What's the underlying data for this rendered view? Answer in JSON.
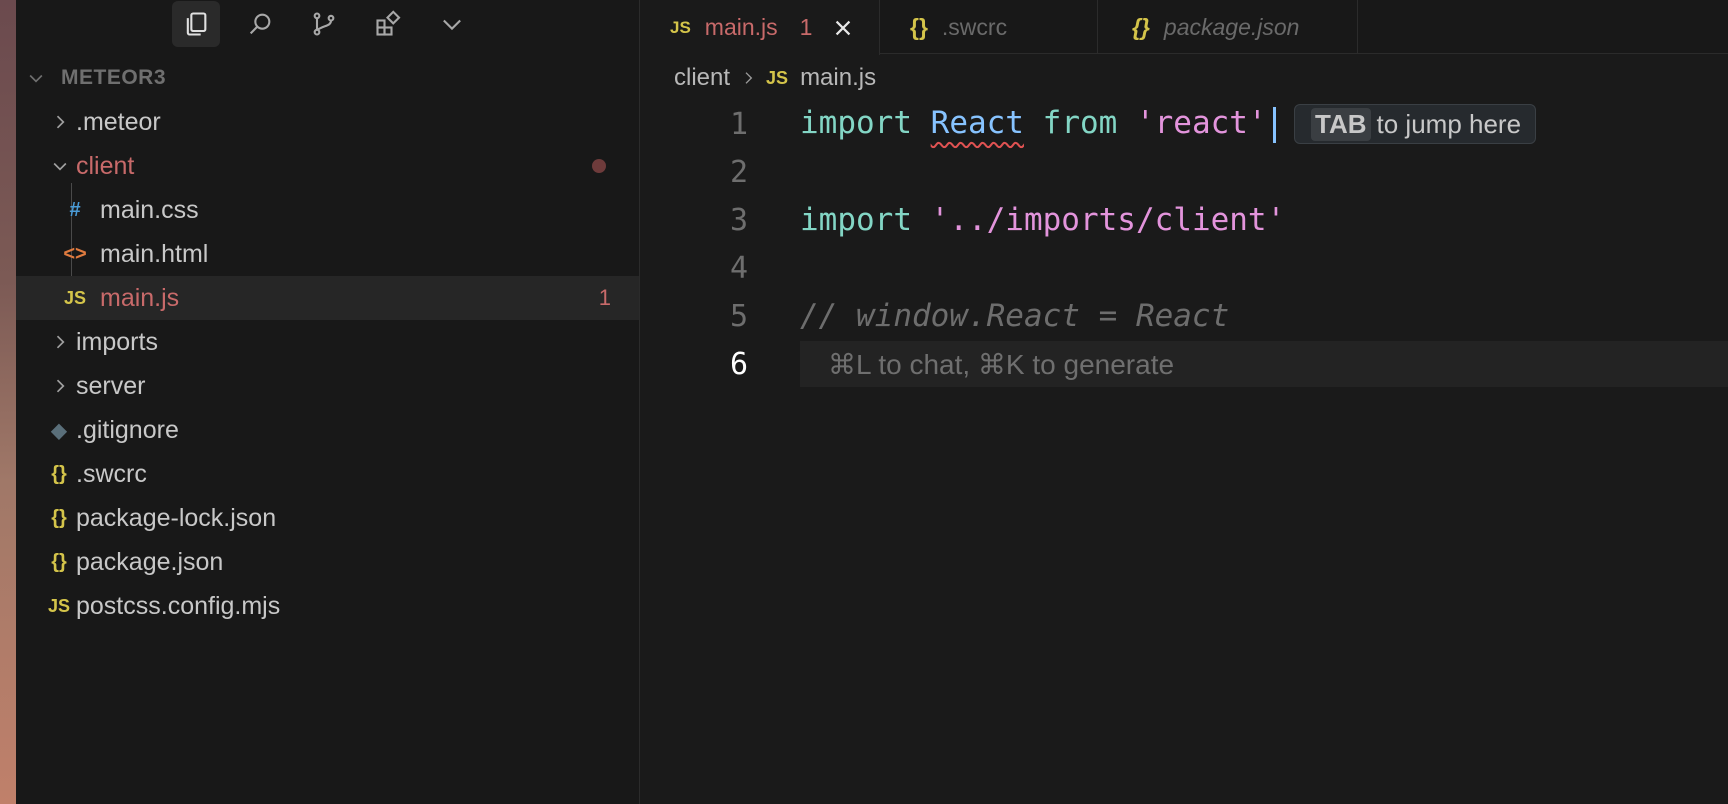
{
  "sidebar": {
    "activity": [
      "explorer-icon",
      "search-icon",
      "source-control-icon",
      "extensions-icon",
      "chevron-down-icon"
    ],
    "workspace": "METEOR3",
    "tree": [
      {
        "label": ".meteor",
        "type": "folder",
        "expanded": false
      },
      {
        "label": "client",
        "type": "folder",
        "expanded": true,
        "modified": true
      },
      {
        "label": "main.css",
        "type": "css",
        "icon": "#"
      },
      {
        "label": "main.html",
        "type": "html",
        "icon": "<>"
      },
      {
        "label": "main.js",
        "type": "js",
        "icon": "JS",
        "problems": "1",
        "selected": true
      },
      {
        "label": "imports",
        "type": "folder",
        "expanded": false
      },
      {
        "label": "server",
        "type": "folder",
        "expanded": false
      },
      {
        "label": ".gitignore",
        "type": "git",
        "icon": "◆"
      },
      {
        "label": ".swcrc",
        "type": "json",
        "icon": "{}"
      },
      {
        "label": "package-lock.json",
        "type": "json",
        "icon": "{}"
      },
      {
        "label": "package.json",
        "type": "json",
        "icon": "{}"
      },
      {
        "label": "postcss.config.mjs",
        "type": "js",
        "icon": "JS"
      }
    ]
  },
  "tabs": [
    {
      "icon": "JS",
      "label": "main.js",
      "count": "1",
      "active": true
    },
    {
      "icon": "{}",
      "label": ".swcrc",
      "active": false
    },
    {
      "icon": "{}",
      "label": "package.json",
      "active": false,
      "italic": true
    }
  ],
  "breadcrumb": {
    "folder": "client",
    "file_icon": "JS",
    "file": "main.js"
  },
  "code": {
    "line_numbers": [
      "1",
      "2",
      "3",
      "4",
      "5",
      "6"
    ],
    "line1": {
      "kw1": "import",
      "id": "React",
      "kw2": "from",
      "str": "'react'"
    },
    "line3": {
      "kw": "import",
      "str": "'../imports/client'"
    },
    "line5": "// window.React = React",
    "tab_hint": {
      "key": "TAB",
      "text": "to jump here"
    },
    "ghost": "⌘L to chat, ⌘K to generate"
  },
  "colors": {
    "error": "#c86a6a",
    "keyword": "#83d6c5",
    "identifier": "#87c3ff",
    "string": "#e394dc",
    "js_icon": "#d4c44a"
  }
}
